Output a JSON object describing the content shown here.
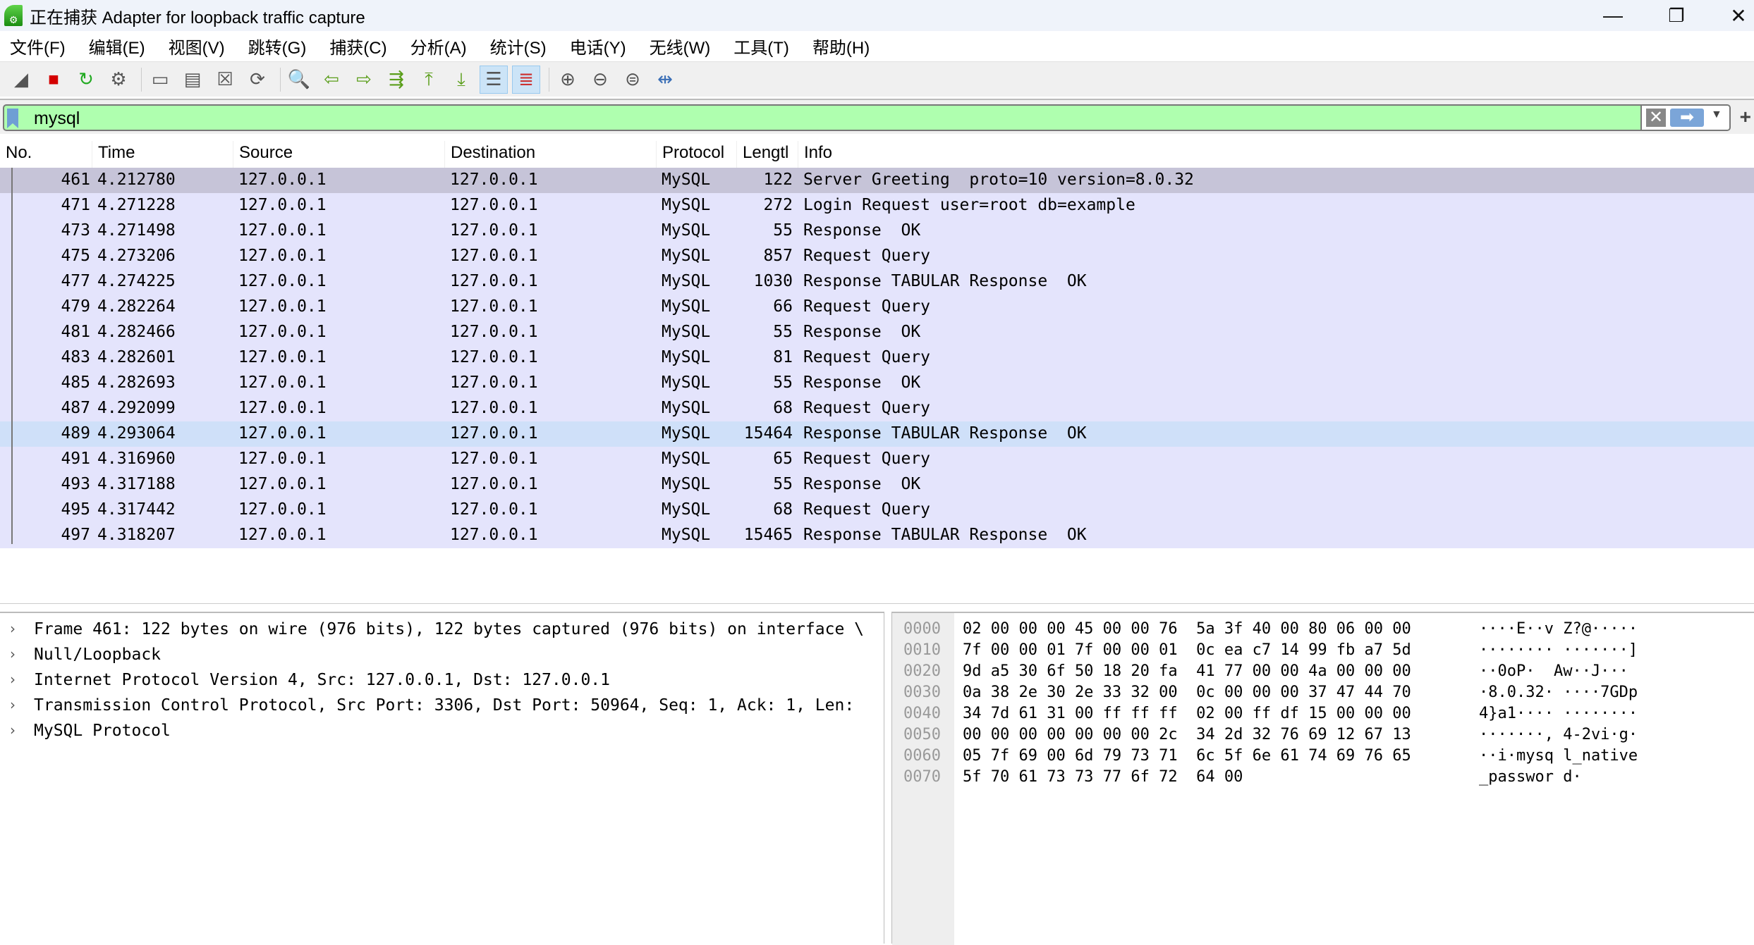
{
  "window": {
    "title": "正在捕获 Adapter for loopback traffic capture",
    "minimize": "—",
    "restore": "❐",
    "close": "✕"
  },
  "menu": [
    "文件(F)",
    "编辑(E)",
    "视图(V)",
    "跳转(G)",
    "捕获(C)",
    "分析(A)",
    "统计(S)",
    "电话(Y)",
    "无线(W)",
    "工具(T)",
    "帮助(H)"
  ],
  "toolbar": [
    {
      "name": "start-capture-icon",
      "glyph": "◢"
    },
    {
      "name": "stop-capture-icon",
      "glyph": "■",
      "color": "#d40000"
    },
    {
      "name": "restart-capture-icon",
      "glyph": "↻",
      "color": "#22aa22"
    },
    {
      "name": "capture-options-icon",
      "glyph": "⚙"
    },
    {
      "sep": true
    },
    {
      "name": "open-file-icon",
      "glyph": "▭"
    },
    {
      "name": "save-file-icon",
      "glyph": "▤"
    },
    {
      "name": "close-file-icon",
      "glyph": "☒"
    },
    {
      "name": "reload-file-icon",
      "glyph": "⟳"
    },
    {
      "sep": true
    },
    {
      "name": "find-packet-icon",
      "glyph": "🔍"
    },
    {
      "name": "go-back-icon",
      "glyph": "⇦",
      "color": "#5a9e1a"
    },
    {
      "name": "go-forward-icon",
      "glyph": "⇨",
      "color": "#5a9e1a"
    },
    {
      "name": "go-to-packet-icon",
      "glyph": "⇶",
      "color": "#5a9e1a"
    },
    {
      "name": "first-packet-icon",
      "glyph": "⤒",
      "color": "#5a9e1a"
    },
    {
      "name": "last-packet-icon",
      "glyph": "⤓",
      "color": "#5a9e1a"
    },
    {
      "name": "autoscroll-icon",
      "glyph": "☰",
      "active": true
    },
    {
      "name": "colorize-icon",
      "glyph": "≣",
      "active": true,
      "color": "#c33"
    },
    {
      "sep": true
    },
    {
      "name": "zoom-in-icon",
      "glyph": "⊕"
    },
    {
      "name": "zoom-out-icon",
      "glyph": "⊖"
    },
    {
      "name": "normal-size-icon",
      "glyph": "⊜"
    },
    {
      "name": "resize-columns-icon",
      "glyph": "⇹",
      "color": "#3b6fb6"
    }
  ],
  "filter": {
    "value": "mysql",
    "clear": "✕",
    "apply": "➡",
    "dropdown": "▼",
    "add": "+",
    "bg_color": "#afffaf"
  },
  "packet_list": {
    "columns": [
      "No.",
      "Time",
      "Source",
      "Destination",
      "Protocol",
      "Lengtl",
      "Info"
    ],
    "rows": [
      [
        "461",
        "4.212780",
        "127.0.0.1",
        "127.0.0.1",
        "MySQL",
        "122",
        "Server Greeting  proto=10 version=8.0.32"
      ],
      [
        "471",
        "4.271228",
        "127.0.0.1",
        "127.0.0.1",
        "MySQL",
        "272",
        "Login Request user=root db=example"
      ],
      [
        "473",
        "4.271498",
        "127.0.0.1",
        "127.0.0.1",
        "MySQL",
        "55",
        "Response  OK"
      ],
      [
        "475",
        "4.273206",
        "127.0.0.1",
        "127.0.0.1",
        "MySQL",
        "857",
        "Request Query"
      ],
      [
        "477",
        "4.274225",
        "127.0.0.1",
        "127.0.0.1",
        "MySQL",
        "1030",
        "Response TABULAR Response  OK"
      ],
      [
        "479",
        "4.282264",
        "127.0.0.1",
        "127.0.0.1",
        "MySQL",
        "66",
        "Request Query"
      ],
      [
        "481",
        "4.282466",
        "127.0.0.1",
        "127.0.0.1",
        "MySQL",
        "55",
        "Response  OK"
      ],
      [
        "483",
        "4.282601",
        "127.0.0.1",
        "127.0.0.1",
        "MySQL",
        "81",
        "Request Query"
      ],
      [
        "485",
        "4.282693",
        "127.0.0.1",
        "127.0.0.1",
        "MySQL",
        "55",
        "Response  OK"
      ],
      [
        "487",
        "4.292099",
        "127.0.0.1",
        "127.0.0.1",
        "MySQL",
        "68",
        "Request Query"
      ],
      [
        "489",
        "4.293064",
        "127.0.0.1",
        "127.0.0.1",
        "MySQL",
        "15464",
        "Response TABULAR Response  OK"
      ],
      [
        "491",
        "4.316960",
        "127.0.0.1",
        "127.0.0.1",
        "MySQL",
        "65",
        "Request Query"
      ],
      [
        "493",
        "4.317188",
        "127.0.0.1",
        "127.0.0.1",
        "MySQL",
        "55",
        "Response  OK"
      ],
      [
        "495",
        "4.317442",
        "127.0.0.1",
        "127.0.0.1",
        "MySQL",
        "68",
        "Request Query"
      ],
      [
        "497",
        "4.318207",
        "127.0.0.1",
        "127.0.0.1",
        "MySQL",
        "15465",
        "Response TABULAR Response  OK"
      ]
    ],
    "selected_row": "461",
    "hover_row": "489"
  },
  "details": [
    "Frame 461: 122 bytes on wire (976 bits), 122 bytes captured (976 bits) on interface \\",
    "Null/Loopback",
    "Internet Protocol Version 4, Src: 127.0.0.1, Dst: 127.0.0.1",
    "Transmission Control Protocol, Src Port: 3306, Dst Port: 50964, Seq: 1, Ack: 1, Len:",
    "MySQL Protocol"
  ],
  "details_chevron": "›",
  "hex": [
    {
      "off": "0000",
      "bytes": "02 00 00 00 45 00 00 76  5a 3f 40 00 80 06 00 00",
      "ascii": "····E··v Z?@·····"
    },
    {
      "off": "0010",
      "bytes": "7f 00 00 01 7f 00 00 01  0c ea c7 14 99 fb a7 5d",
      "ascii": "········ ·······]"
    },
    {
      "off": "0020",
      "bytes": "9d a5 30 6f 50 18 20 fa  41 77 00 00 4a 00 00 00",
      "ascii": "··0oP·  Aw··J···"
    },
    {
      "off": "0030",
      "bytes": "0a 38 2e 30 2e 33 32 00  0c 00 00 00 37 47 44 70",
      "ascii": "·8.0.32· ····7GDp"
    },
    {
      "off": "0040",
      "bytes": "34 7d 61 31 00 ff ff ff  02 00 ff df 15 00 00 00",
      "ascii": "4}a1···· ········"
    },
    {
      "off": "0050",
      "bytes": "00 00 00 00 00 00 00 2c  34 2d 32 76 69 12 67 13",
      "ascii": "·······, 4-2vi·g·"
    },
    {
      "off": "0060",
      "bytes": "05 7f 69 00 6d 79 73 71  6c 5f 6e 61 74 69 76 65",
      "ascii": "··i·mysq l_native"
    },
    {
      "off": "0070",
      "bytes": "5f 70 61 73 73 77 6f 72  64 00",
      "ascii": "_passwor d·"
    }
  ]
}
